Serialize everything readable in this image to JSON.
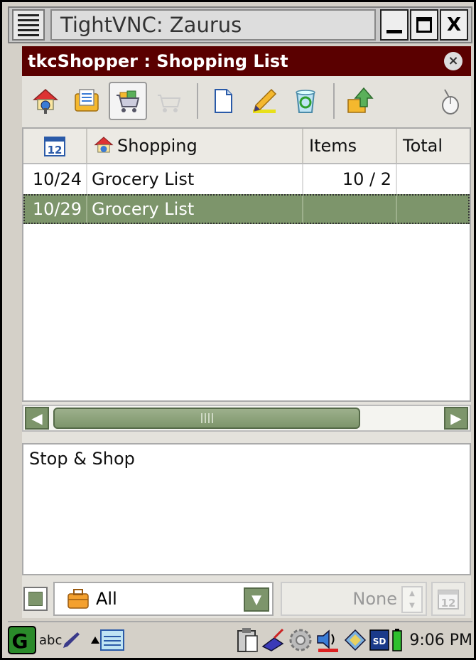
{
  "window": {
    "title": "TightVNC: Zaurus",
    "min_glyph": "_",
    "close_glyph": "X"
  },
  "app": {
    "title": "tkcShopper : Shopping List",
    "close_glyph": "×"
  },
  "toolbar": {
    "items": [
      {
        "name": "stores-icon"
      },
      {
        "name": "list-icon"
      },
      {
        "name": "shopping-cart-icon",
        "active": true
      },
      {
        "name": "checkout-icon",
        "disabled": true
      },
      {
        "name": "new-document-icon"
      },
      {
        "name": "edit-pencil-icon"
      },
      {
        "name": "recycle-icon"
      },
      {
        "name": "export-arrow-icon"
      },
      {
        "name": "mouse-icon"
      }
    ]
  },
  "table": {
    "headers": {
      "date_icon": "12",
      "shopping": "Shopping",
      "items": "Items",
      "total": "Total"
    },
    "rows": [
      {
        "date": "10/24",
        "name": "Grocery List",
        "items": "10 / 2",
        "total": "",
        "selected": false
      },
      {
        "date": "10/29",
        "name": "Grocery List",
        "items": "",
        "total": "",
        "selected": true
      }
    ]
  },
  "notes": {
    "text": "Stop & Shop"
  },
  "filter": {
    "category": "All",
    "priority": "None",
    "cal_label": "12"
  },
  "taskbar": {
    "ime": "abc",
    "time": "9:06 PM",
    "sd_label": "SD"
  },
  "colors": {
    "titlebar": "#5a0000",
    "selection": "#7d956b",
    "accent_border": "#556a48"
  }
}
